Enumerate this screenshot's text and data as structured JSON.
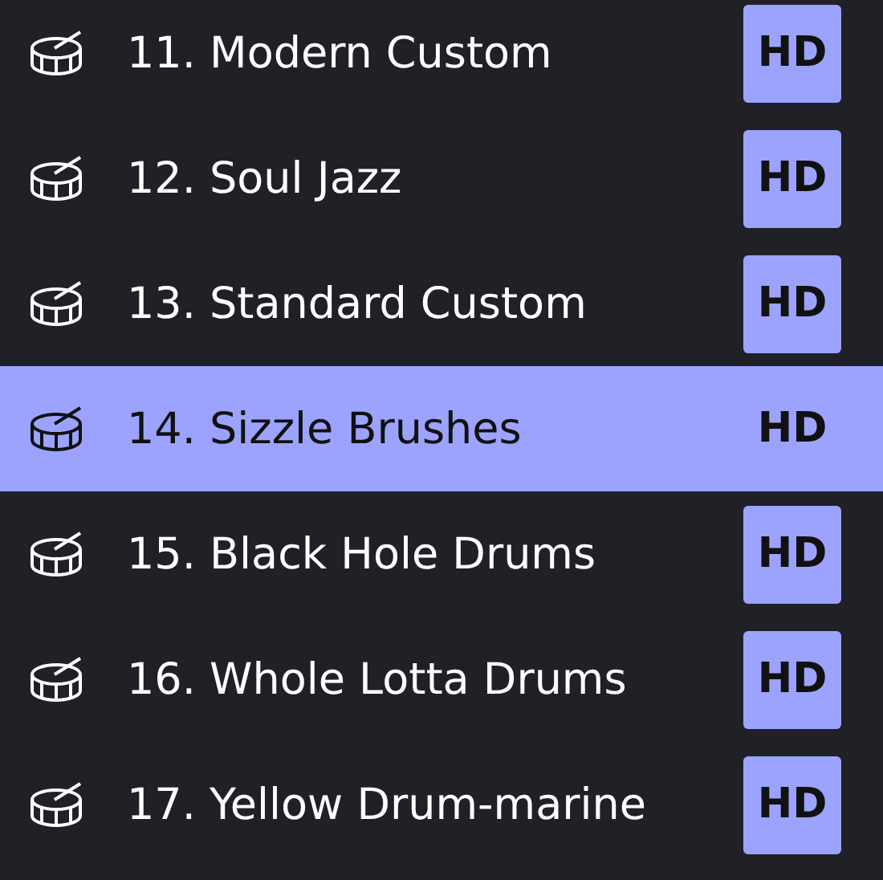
{
  "kits": [
    {
      "name": "11. Modern Custom",
      "badge": "HD",
      "selected": false
    },
    {
      "name": "12. Soul Jazz",
      "badge": "HD",
      "selected": false
    },
    {
      "name": "13. Standard Custom",
      "badge": "HD",
      "selected": false
    },
    {
      "name": "14. Sizzle Brushes",
      "badge": "HD",
      "selected": true
    },
    {
      "name": "15. Black Hole Drums",
      "badge": "HD",
      "selected": false
    },
    {
      "name": "16. Whole Lotta Drums",
      "badge": "HD",
      "selected": false
    },
    {
      "name": "17. Yellow Drum-marine",
      "badge": "HD",
      "selected": false
    }
  ]
}
